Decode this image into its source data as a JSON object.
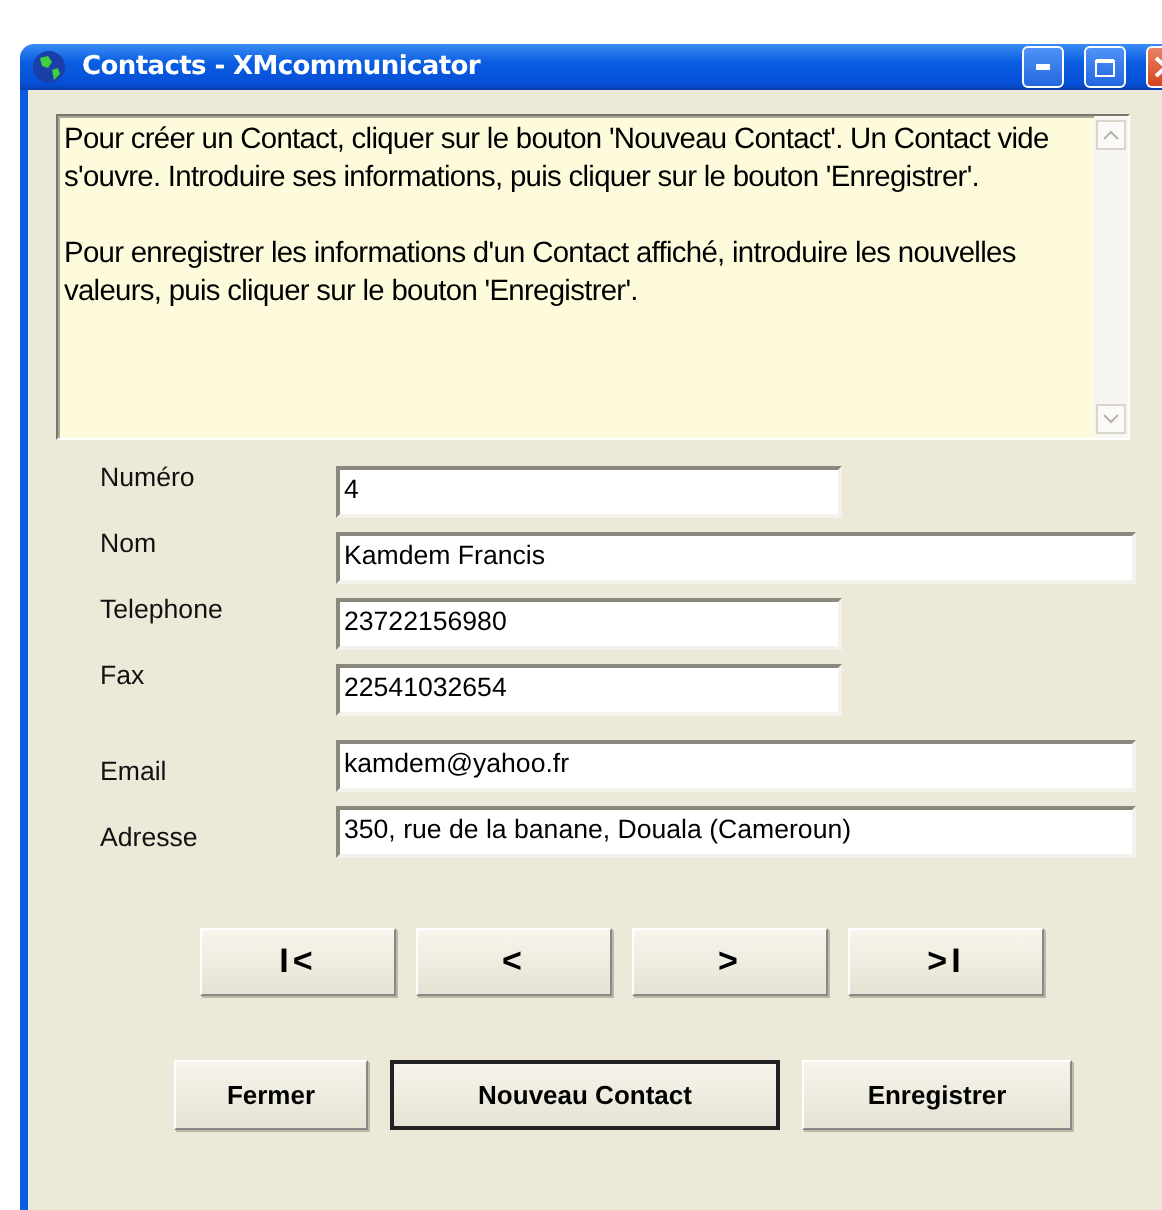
{
  "window": {
    "title": "Contacts - XMcommunicator"
  },
  "help_text": [
    "Pour créer un Contact, cliquer sur le bouton 'Nouveau Contact'. Un Contact vide s'ouvre. Introduire ses informations, puis cliquer sur le bouton 'Enregistrer'.",
    "Pour enregistrer les informations d'un Contact affiché, introduire les nouvelles valeurs, puis cliquer sur le bouton 'Enregistrer'."
  ],
  "fields": [
    {
      "label": "Numéro",
      "value": "4",
      "kind": "short"
    },
    {
      "label": "Nom",
      "value": "Kamdem Francis",
      "kind": "long"
    },
    {
      "label": "Telephone",
      "value": "23722156980",
      "kind": "short"
    },
    {
      "label": "Fax",
      "value": "22541032654",
      "kind": "short"
    },
    {
      "label": "Email",
      "value": "kamdem@yahoo.fr",
      "kind": "long"
    },
    {
      "label": "Adresse",
      "value": "350, rue de la banane, Douala (Cameroun)",
      "kind": "long"
    }
  ],
  "navigation": [
    "I<",
    "<",
    ">",
    ">I"
  ],
  "buttons": [
    {
      "label": "Fermer",
      "default": false
    },
    {
      "label": "Nouveau Contact",
      "default": true
    },
    {
      "label": "Enregistrer",
      "default": false
    }
  ]
}
